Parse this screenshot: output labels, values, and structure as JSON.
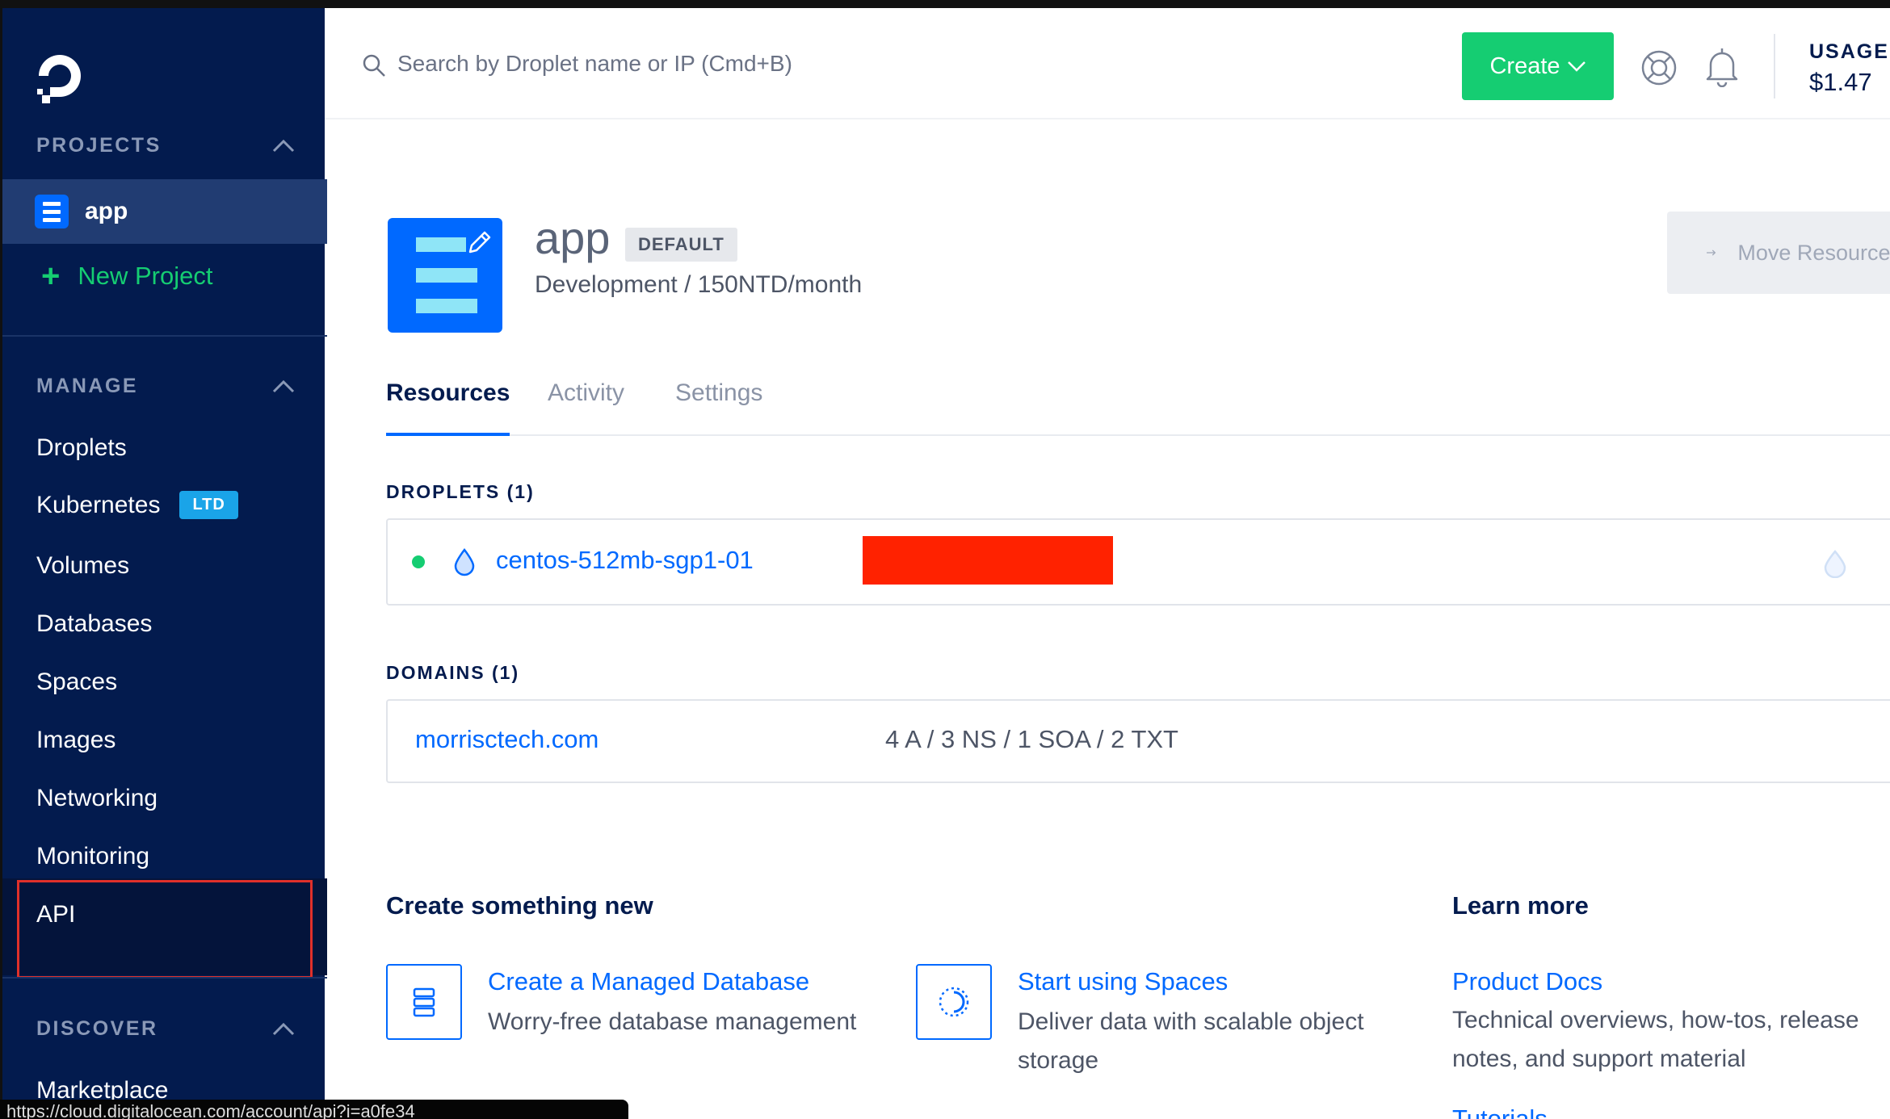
{
  "sidebar": {
    "projects_header": "PROJECTS",
    "active_project": "app",
    "new_project": "New Project",
    "manage_header": "MANAGE",
    "manage_items": [
      "Droplets",
      "Kubernetes",
      "Volumes",
      "Databases",
      "Spaces",
      "Images",
      "Networking",
      "Monitoring",
      "API"
    ],
    "kubernetes_badge": "LTD",
    "discover_header": "DISCOVER",
    "discover_items": [
      "Marketplace"
    ]
  },
  "status_url": "https://cloud.digitalocean.com/account/api?i=a0fe34",
  "header": {
    "search_placeholder": "Search by Droplet name or IP (Cmd+B)",
    "create_label": "Create",
    "usage_label": "USAGE",
    "usage_value": "$1.47"
  },
  "project": {
    "name": "app",
    "badge": "DEFAULT",
    "subtitle": "Development / 150NTD/month",
    "move_label": "Move Resources"
  },
  "tabs": [
    "Resources",
    "Activity",
    "Settings"
  ],
  "droplets": {
    "header": "DROPLETS (1)",
    "items": [
      {
        "name": "centos-512mb-sgp1-01"
      }
    ]
  },
  "domains": {
    "header": "DOMAINS (1)",
    "items": [
      {
        "name": "morrisctech.com",
        "records": "4 A / 3 NS / 1 SOA / 2 TXT"
      }
    ]
  },
  "create_new": {
    "header": "Create something new",
    "items": [
      {
        "title": "Create a Managed Database",
        "desc": "Worry-free database management"
      },
      {
        "title": "Start using Spaces",
        "desc": "Deliver data with scalable object storage"
      }
    ]
  },
  "learn_more": {
    "header": "Learn more",
    "items": [
      {
        "title": "Product Docs",
        "desc": "Technical overviews, how-tos, release notes, and support material"
      },
      {
        "title": "Tutorials"
      }
    ]
  },
  "colors": {
    "sidebar_bg": "#031b4e",
    "accent_blue": "#0069ff",
    "accent_green": "#15cd72",
    "highlight_red": "#e0302a"
  }
}
